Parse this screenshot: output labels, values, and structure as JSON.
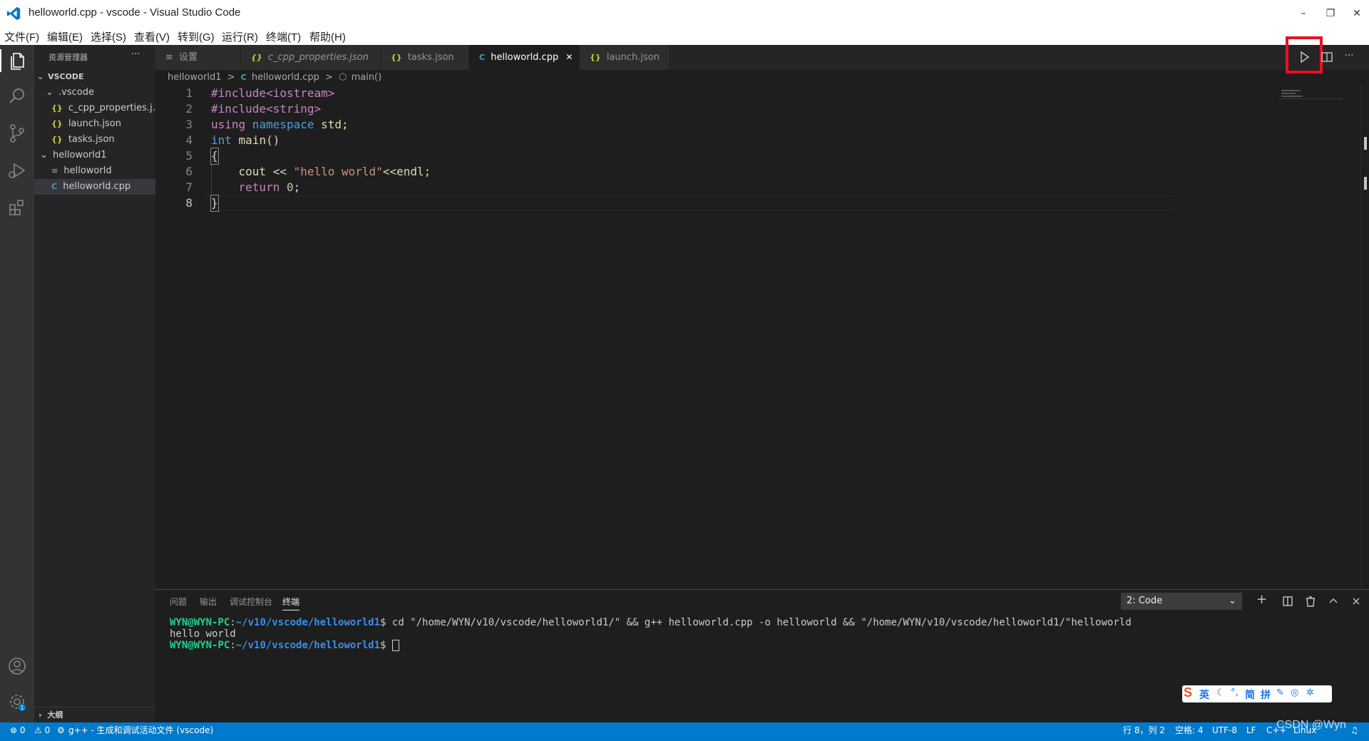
{
  "window": {
    "title": "helloworld.cpp - vscode - Visual Studio Code",
    "minimize": "–",
    "restore": "❐",
    "close": "✕"
  },
  "menu": [
    "文件(F)",
    "编辑(E)",
    "选择(S)",
    "查看(V)",
    "转到(G)",
    "运行(R)",
    "终端(T)",
    "帮助(H)"
  ],
  "sidebar": {
    "header": "资源管理器",
    "more": "···",
    "root": "VSCODE",
    "folder_vscode": ".vscode",
    "files": [
      "c_cpp_properties.j…",
      "launch.json",
      "tasks.json"
    ],
    "folder_hw": "helloworld1",
    "hw_files": [
      "helloworld",
      "helloworld.cpp"
    ],
    "outline": "大纲",
    "json_icon": "{}",
    "cpp_icon": "C"
  },
  "tabs": [
    {
      "icon": "≡",
      "label": "设置"
    },
    {
      "icon": "{}",
      "label": "c_cpp_properties.json"
    },
    {
      "icon": "{}",
      "label": "tasks.json"
    },
    {
      "icon": "C",
      "label": "helloworld.cpp",
      "close": "✕"
    },
    {
      "icon": "{}",
      "label": "launch.json"
    }
  ],
  "breadcrumb": {
    "folder": "helloworld1",
    "file": "helloworld.cpp",
    "symbol": "main()",
    "sep": ">"
  },
  "editor": {
    "line_numbers": [
      "1",
      "2",
      "3",
      "4",
      "5",
      "6",
      "7",
      "8"
    ],
    "lines": {
      "l1a": "#include<iostream>",
      "l2a": "#include<string>",
      "l3a": "using",
      "l3b": " namespace",
      "l3c": " std;",
      "l4a": "int",
      "l4b": " main",
      "l4c": "()",
      "l5a": "{",
      "l6a": "    cout",
      "l6b": " << ",
      "l6c": "\"hello world\"",
      "l6d": "<<endl;",
      "l7a": "    return ",
      "l7b": "0",
      "l7c": ";",
      "l8a": "}"
    }
  },
  "panel": {
    "tabs": [
      "问题",
      "输出",
      "调试控制台",
      "终端"
    ],
    "terminal_select": "2: Code",
    "terminal": {
      "prompt": "WYN@WYN-PC",
      "colon": ":",
      "path": "~/v10/vscode/helloworld1",
      "dollar": "$ ",
      "cmd": "cd \"/home/WYN/v10/vscode/helloworld1/\" && g++ helloworld.cpp -o helloworld && \"/home/WYN/v10/vscode/helloworld1/\"helloworld",
      "output": "hello world"
    }
  },
  "statusbar": {
    "errors": "⊗ 0",
    "warnings": "⚠ 0",
    "task": "g++ - 生成和调试活动文件 (vscode)",
    "position": "行 8，列 2",
    "spaces": "空格: 4",
    "encoding": "UTF-8",
    "eol": "LF",
    "lang": "C++",
    "os": "Linux"
  },
  "ime": {
    "labels": [
      "英",
      "简",
      "拼"
    ]
  },
  "watermark": "CSDN @Wyn"
}
